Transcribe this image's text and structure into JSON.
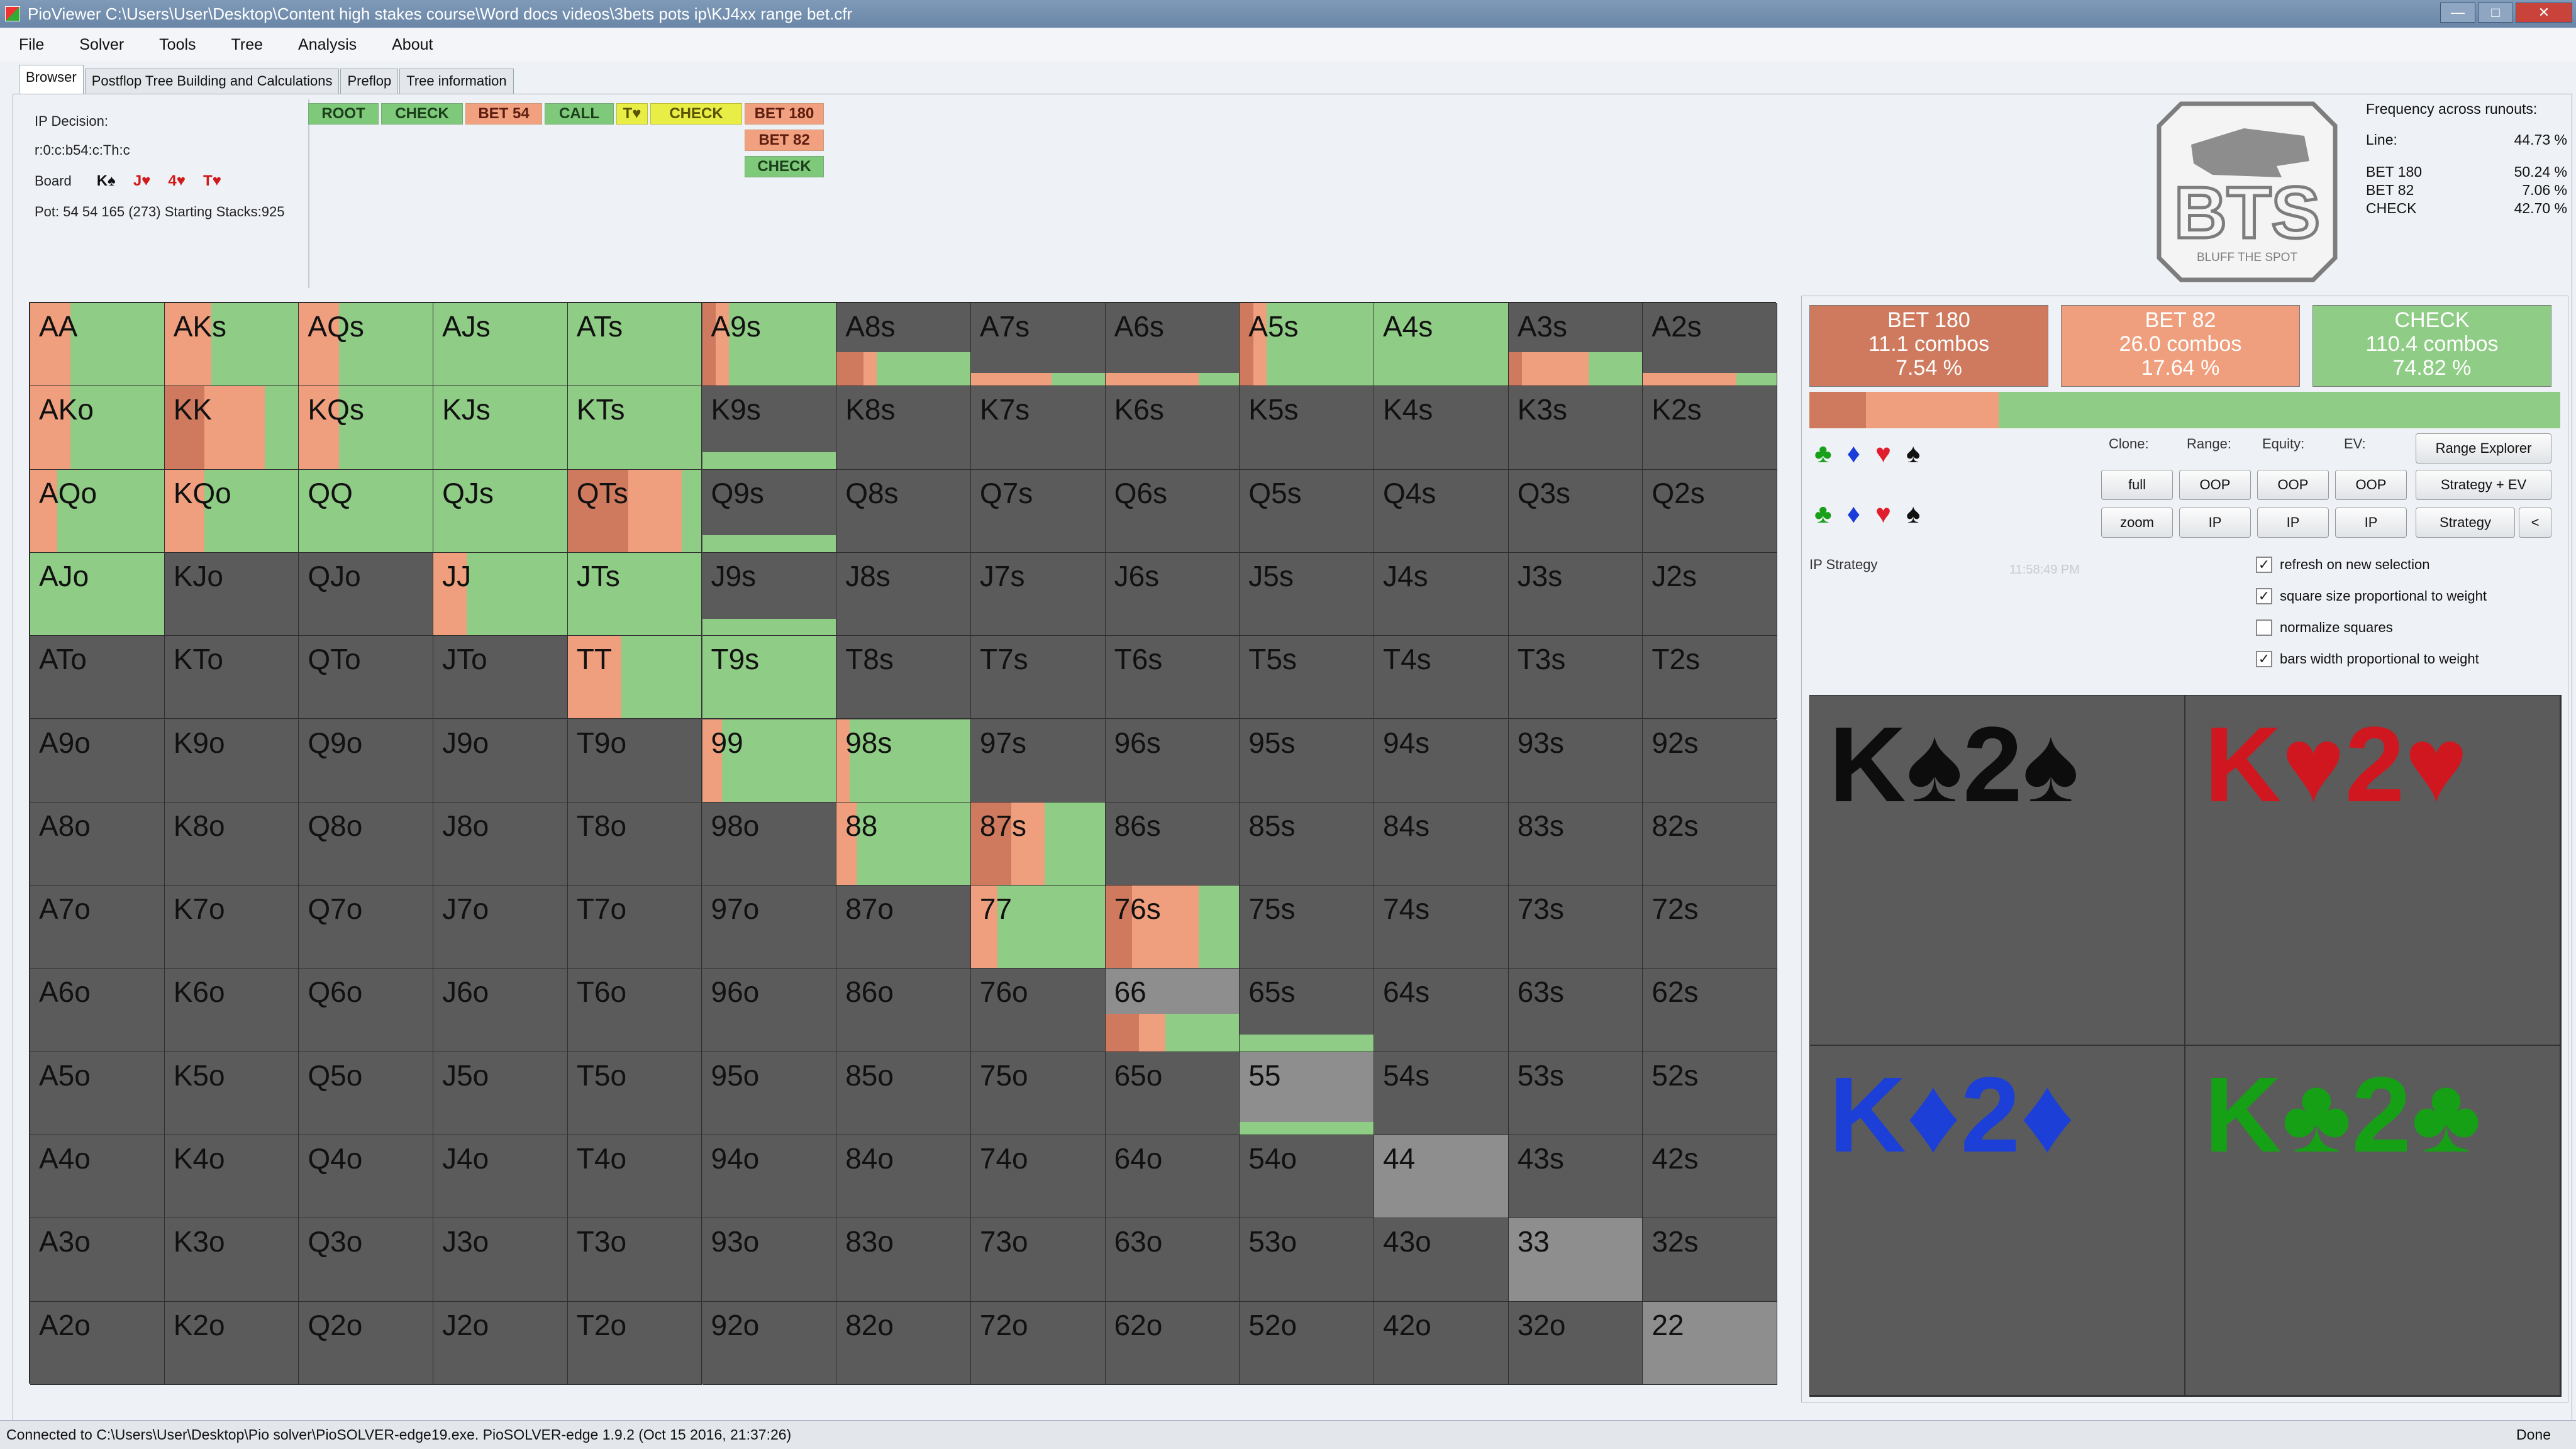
{
  "window": {
    "title": "PioViewer C:\\Users\\User\\Desktop\\Content high stakes course\\Word docs videos\\3bets pots ip\\KJ4xx range bet.cfr",
    "buttons": [
      "—",
      "□",
      "✕"
    ]
  },
  "menu": [
    "File",
    "Solver",
    "Tools",
    "Tree",
    "Analysis",
    "About"
  ],
  "tabs": [
    "Browser",
    "Postflop Tree Building and Calculations",
    "Preflop",
    "Tree information"
  ],
  "info": {
    "decision": "IP Decision:",
    "line": "r:0:c:b54:c:Th:c",
    "board_label": "Board",
    "board": [
      {
        "card": "K♠",
        "color": "#111111"
      },
      {
        "card": "J♥",
        "color": "#d01919"
      },
      {
        "card": "4♥",
        "color": "#d01919"
      },
      {
        "card": "T♥",
        "color": "#d01919"
      }
    ],
    "pot": "Pot: 54 54 165 (273) Starting Stacks:925"
  },
  "tree": [
    {
      "label": "ROOT",
      "style": "g"
    },
    {
      "label": "CHECK",
      "style": "g"
    },
    {
      "label": "BET 54",
      "style": "o"
    },
    {
      "label": "CALL",
      "style": "g"
    },
    {
      "label": "T♥",
      "style": "y"
    },
    {
      "label": "CHECK",
      "style": "y"
    },
    {
      "label": "BET 180",
      "style": "o"
    },
    {
      "label": "BET 82",
      "style": "o"
    },
    {
      "label": "CHECK",
      "style": "g"
    }
  ],
  "logo": {
    "text": "BTS",
    "tagline": "BLUFF THE SPOT"
  },
  "frequency": {
    "title": "Frequency across runouts:",
    "rows": [
      {
        "label": "Line:",
        "value": "44.73 %"
      },
      {
        "label": "BET 180",
        "value": "50.24 %"
      },
      {
        "label": "BET 82",
        "value": "7.06 %"
      },
      {
        "label": "CHECK",
        "value": "42.70 %"
      }
    ]
  },
  "colors": {
    "bet180": "#cf7a5e",
    "bet82": "#ef9f7d",
    "check": "#8fcc85",
    "empty": "#5b5b5b",
    "pair_grey": "#8e8e8e"
  },
  "grid": {
    "labels": [
      [
        "AA",
        "AKs",
        "AQs",
        "AJs",
        "ATs",
        "A9s",
        "A8s",
        "A7s",
        "A6s",
        "A5s",
        "A4s",
        "A3s",
        "A2s"
      ],
      [
        "AKo",
        "KK",
        "KQs",
        "KJs",
        "KTs",
        "K9s",
        "K8s",
        "K7s",
        "K6s",
        "K5s",
        "K4s",
        "K3s",
        "K2s"
      ],
      [
        "AQo",
        "KQo",
        "QQ",
        "QJs",
        "QTs",
        "Q9s",
        "Q8s",
        "Q7s",
        "Q6s",
        "Q5s",
        "Q4s",
        "Q3s",
        "Q2s"
      ],
      [
        "AJo",
        "KJo",
        "QJo",
        "JJ",
        "JTs",
        "J9s",
        "J8s",
        "J7s",
        "J6s",
        "J5s",
        "J4s",
        "J3s",
        "J2s"
      ],
      [
        "ATo",
        "KTo",
        "QTo",
        "JTo",
        "TT",
        "T9s",
        "T8s",
        "T7s",
        "T6s",
        "T5s",
        "T4s",
        "T3s",
        "T2s"
      ],
      [
        "A9o",
        "K9o",
        "Q9o",
        "J9o",
        "T9o",
        "99",
        "98s",
        "97s",
        "96s",
        "95s",
        "94s",
        "93s",
        "92s"
      ],
      [
        "A8o",
        "K8o",
        "Q8o",
        "J8o",
        "T8o",
        "98o",
        "88",
        "87s",
        "86s",
        "85s",
        "84s",
        "83s",
        "82s"
      ],
      [
        "A7o",
        "K7o",
        "Q7o",
        "J7o",
        "T7o",
        "97o",
        "87o",
        "77",
        "76s",
        "75s",
        "74s",
        "73s",
        "72s"
      ],
      [
        "A6o",
        "K6o",
        "Q6o",
        "J6o",
        "T6o",
        "96o",
        "86o",
        "76o",
        "66",
        "65s",
        "64s",
        "63s",
        "62s"
      ],
      [
        "A5o",
        "K5o",
        "Q5o",
        "J5o",
        "T5o",
        "95o",
        "85o",
        "75o",
        "65o",
        "55",
        "54s",
        "53s",
        "52s"
      ],
      [
        "A4o",
        "K4o",
        "Q4o",
        "J4o",
        "T4o",
        "94o",
        "84o",
        "74o",
        "64o",
        "54o",
        "44",
        "43s",
        "42s"
      ],
      [
        "A3o",
        "K3o",
        "Q3o",
        "J3o",
        "T3o",
        "93o",
        "83o",
        "73o",
        "63o",
        "53o",
        "43o",
        "33",
        "32s"
      ],
      [
        "A2o",
        "K2o",
        "Q2o",
        "J2o",
        "T2o",
        "92o",
        "82o",
        "72o",
        "62o",
        "52o",
        "42o",
        "32o",
        "22"
      ]
    ],
    "strategy": {
      "AA": {
        "w": 1,
        "mix": [
          0,
          0.3,
          0.7
        ]
      },
      "AKs": {
        "w": 1,
        "mix": [
          0,
          0.35,
          0.65
        ]
      },
      "AQs": {
        "w": 1,
        "mix": [
          0,
          0.3,
          0.7
        ]
      },
      "AJs": {
        "w": 1,
        "mix": [
          0,
          0,
          1
        ]
      },
      "ATs": {
        "w": 1,
        "mix": [
          0,
          0,
          1
        ]
      },
      "A9s": {
        "w": 1,
        "mix": [
          0.1,
          0.1,
          0.8
        ]
      },
      "A8s": {
        "w": 0.4,
        "mix": [
          0.2,
          0.1,
          0.7
        ]
      },
      "A7s": {
        "w": 0.15,
        "mix": [
          0,
          0.6,
          0.4
        ]
      },
      "A6s": {
        "w": 0.15,
        "mix": [
          0,
          0.7,
          0.3
        ]
      },
      "A5s": {
        "w": 1,
        "mix": [
          0.1,
          0.1,
          0.8
        ]
      },
      "A4s": {
        "w": 1,
        "mix": [
          0,
          0,
          1
        ]
      },
      "A3s": {
        "w": 0.4,
        "mix": [
          0.1,
          0.5,
          0.4
        ]
      },
      "A2s": {
        "w": 0.15,
        "mix": [
          0,
          0.7,
          0.3
        ]
      },
      "AKo": {
        "w": 1,
        "mix": [
          0,
          0.3,
          0.7
        ]
      },
      "KK": {
        "w": 1,
        "mix": [
          0.3,
          0.45,
          0.25
        ]
      },
      "KQs": {
        "w": 1,
        "mix": [
          0,
          0.3,
          0.7
        ]
      },
      "KJs": {
        "w": 1,
        "mix": [
          0,
          0,
          1
        ]
      },
      "KTs": {
        "w": 1,
        "mix": [
          0,
          0,
          1
        ]
      },
      "K9s": {
        "w": 0.2,
        "mix": [
          0,
          0,
          1
        ]
      },
      "AQo": {
        "w": 1,
        "mix": [
          0,
          0.2,
          0.8
        ]
      },
      "KQo": {
        "w": 1,
        "mix": [
          0,
          0.3,
          0.7
        ]
      },
      "QQ": {
        "w": 1,
        "mix": [
          0,
          0,
          1
        ]
      },
      "QJs": {
        "w": 1,
        "mix": [
          0,
          0,
          1
        ]
      },
      "QTs": {
        "w": 1,
        "mix": [
          0.45,
          0.4,
          0.15
        ]
      },
      "Q9s": {
        "w": 0.2,
        "mix": [
          0,
          0,
          1
        ]
      },
      "AJo": {
        "w": 1,
        "mix": [
          0,
          0,
          1
        ]
      },
      "JJ": {
        "w": 1,
        "mix": [
          0,
          0.25,
          0.75
        ]
      },
      "JTs": {
        "w": 1,
        "mix": [
          0,
          0,
          1
        ]
      },
      "J9s": {
        "w": 0.2,
        "mix": [
          0,
          0,
          1
        ]
      },
      "TT": {
        "w": 1,
        "mix": [
          0,
          0.4,
          0.6
        ]
      },
      "T9s": {
        "w": 1,
        "mix": [
          0,
          0,
          1
        ]
      },
      "99": {
        "w": 1,
        "mix": [
          0,
          0.15,
          0.85
        ]
      },
      "98s": {
        "w": 1,
        "mix": [
          0,
          0.1,
          0.9
        ]
      },
      "88": {
        "w": 1,
        "mix": [
          0,
          0.15,
          0.85
        ]
      },
      "87s": {
        "w": 1,
        "mix": [
          0.3,
          0.25,
          0.45
        ]
      },
      "77": {
        "w": 1,
        "mix": [
          0,
          0.2,
          0.8
        ]
      },
      "76s": {
        "w": 1,
        "mix": [
          0.2,
          0.5,
          0.3
        ]
      },
      "66": {
        "w": 0.45,
        "mix": [
          0.25,
          0.2,
          0.55
        ],
        "grey": true
      },
      "65s": {
        "w": 0.2,
        "mix": [
          0,
          0,
          1
        ]
      },
      "55": {
        "w": 0.15,
        "mix": [
          0,
          0,
          1
        ],
        "grey": true
      },
      "44": {
        "w": 0,
        "mix": [
          0,
          0,
          0
        ],
        "grey": true
      },
      "33": {
        "w": 0,
        "mix": [
          0,
          0,
          0
        ],
        "grey": true
      },
      "22": {
        "w": 0,
        "mix": [
          0,
          0,
          0
        ],
        "grey": true
      }
    }
  },
  "actions": [
    {
      "name": "BET 180",
      "combos": "11.1 combos",
      "pct": "7.54 %",
      "color": "#cf7a5e",
      "frac": 0.0754
    },
    {
      "name": "BET 82",
      "combos": "26.0 combos",
      "pct": "17.64 %",
      "color": "#ef9f7d",
      "frac": 0.1764
    },
    {
      "name": "CHECK",
      "combos": "110.4 combos",
      "pct": "74.82 %",
      "color": "#8fcc85",
      "frac": 0.7482
    }
  ],
  "suits": [
    {
      "glyph": "♣",
      "color": "#18a018"
    },
    {
      "glyph": "♦",
      "color": "#1a3cd8"
    },
    {
      "glyph": "♥",
      "color": "#e01d2d"
    },
    {
      "glyph": "♠",
      "color": "#111111"
    }
  ],
  "panel": {
    "labels": {
      "clone": "Clone:",
      "range": "Range:",
      "equity": "Equity:",
      "ev": "EV:"
    },
    "row1": [
      "full",
      "OOP",
      "OOP",
      "OOP"
    ],
    "row2": [
      "zoom",
      "IP",
      "IP",
      "IP"
    ],
    "range_explorer": "Range Explorer",
    "strategy_ev": "Strategy + EV",
    "strategy": "Strategy",
    "arrow": "<",
    "ip_strategy": "IP Strategy",
    "timestamp": "11:58:49 PM"
  },
  "checkboxes": [
    {
      "label": "refresh on new selection",
      "checked": "✓"
    },
    {
      "label": "square size proportional to weight",
      "checked": "✓"
    },
    {
      "label": "normalize squares",
      "checked": ""
    },
    {
      "label": "bars width proportional to weight",
      "checked": "✓"
    }
  ],
  "combos": [
    {
      "text": "K♠2♠",
      "color": "#0d0d0d"
    },
    {
      "text": "K♥2♥",
      "color": "#d0171f"
    },
    {
      "text": "K♦2♦",
      "color": "#1c3fd8"
    },
    {
      "text": "K♣2♣",
      "color": "#16a016"
    }
  ],
  "status": {
    "text": "Connected to C:\\Users\\User\\Desktop\\Pio solver\\PioSOLVER-edge19.exe. PioSOLVER-edge 1.9.2 (Oct 15 2016, 21:37:26)",
    "done": "Done"
  }
}
